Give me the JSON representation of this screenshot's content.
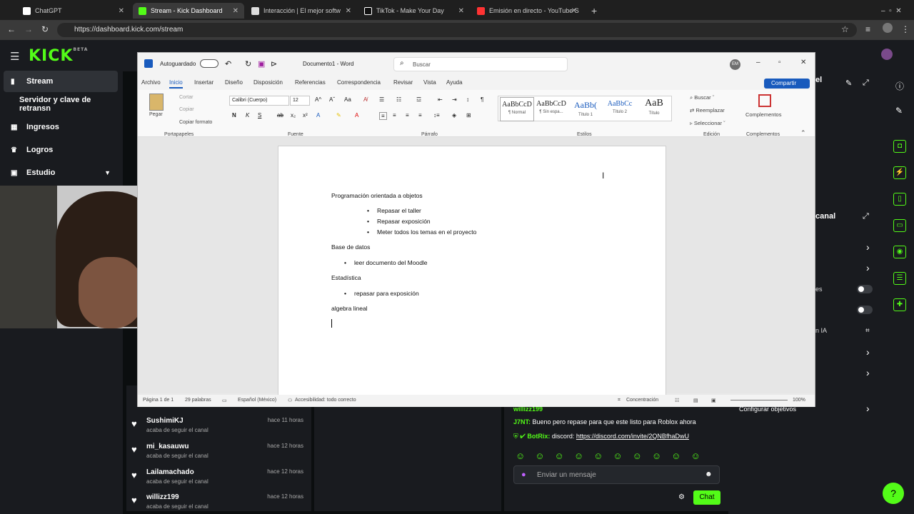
{
  "browser": {
    "tabs": [
      {
        "title": "ChatGPT",
        "color": "#ffffff"
      },
      {
        "title": "Stream - Kick Dashboard",
        "color": "#53fc18"
      },
      {
        "title": "Interacción | El mejor softw",
        "color": "#dddddd"
      },
      {
        "title": "TikTok - Make Your Day",
        "color": "#ffffff"
      },
      {
        "title": "Emisión en directo - YouTube S",
        "color": "#ff3333"
      }
    ],
    "url": "https://dashboard.kick.com/stream"
  },
  "kick": {
    "logo": "KICK",
    "beta": "BETA",
    "sidebar": [
      {
        "label": "Stream",
        "icon": "stream-icon"
      },
      {
        "label": "Servidor y clave de retransn",
        "icon": "key-icon"
      },
      {
        "label": "Ingresos",
        "icon": "chart-icon"
      },
      {
        "label": "Logros",
        "icon": "trophy-icon"
      },
      {
        "label": "Estudio",
        "icon": "studio-icon"
      }
    ],
    "follows": [
      {
        "name": "SushimiKJ",
        "sub": "acaba de seguir el canal",
        "time": "hace 11 horas"
      },
      {
        "name": "mi_kasauwu",
        "sub": "acaba de seguir el canal",
        "time": "hace 12 horas"
      },
      {
        "name": "Lailamachado",
        "sub": "acaba de seguir el canal",
        "time": "hace 12 horas"
      },
      {
        "name": "willizz199",
        "sub": "acaba de seguir el canal",
        "time": "hace 12 horas"
      }
    ],
    "chat": {
      "partial_user": "willizz199",
      "line1_user": "J7NT:",
      "line1_text": " Bueno pero repase para que este listo para Roblox ahora",
      "line2_user": "BotRix:",
      "line2_text": " discord: ",
      "line2_link": "https://discord.com/invite/2QNBfhaDwU",
      "placeholder": "Enviar un mensaje",
      "button": "Chat"
    },
    "right": {
      "el": "el",
      "canal": "canal",
      "es": "es",
      "ia": "n IA",
      "configurar": "Configurar objetivos"
    }
  },
  "word": {
    "autosave": "Autoguardado",
    "doc_title": "Documento1 - Word",
    "search": "Buscar",
    "avatar": "EM",
    "share": "Compartir",
    "menus": [
      "Archivo",
      "Inicio",
      "Insertar",
      "Diseño",
      "Disposición",
      "Referencias",
      "Correspondencia",
      "Revisar",
      "Vista",
      "Ayuda"
    ],
    "ribbon": {
      "paste": "Pegar",
      "cut": "Cortar",
      "copy": "Copiar",
      "format_painter": "Copiar formato",
      "font": "Calibri (Cuerpo)",
      "size": "12",
      "groups": [
        "Portapapeles",
        "Fuente",
        "Párrafo",
        "Estilos",
        "Edición",
        "Complementos"
      ],
      "styles": [
        {
          "preview": "AaBbCcD",
          "label": "¶ Normal"
        },
        {
          "preview": "AaBbCcD",
          "label": "¶ Sin espa..."
        },
        {
          "preview": "AaBb(",
          "label": "Título 1"
        },
        {
          "preview": "AaBbCc",
          "label": "Título 2"
        },
        {
          "preview": "AaB",
          "label": "Título"
        }
      ],
      "find": "Buscar",
      "replace": "Reemplazar",
      "select": "Seleccionar",
      "addins": "Complementos"
    },
    "document": {
      "h1": "Programación orientada a objetos",
      "b1": "Repasar el taller",
      "b2": "Repasar exposición",
      "b3": "Meter todos los temas en el proyecto",
      "h2": "Base de datos",
      "b4": "leer documento del Moodle",
      "h3": "Estadística",
      "b5": "repasar para exposición",
      "h4": "algebra lineal"
    },
    "status": {
      "page": "Página 1 de 1",
      "words": "29 palabras",
      "lang": "Español (México)",
      "access": "Accesibilidad: todo correcto",
      "focus": "Concentración",
      "zoom": "100%"
    }
  }
}
